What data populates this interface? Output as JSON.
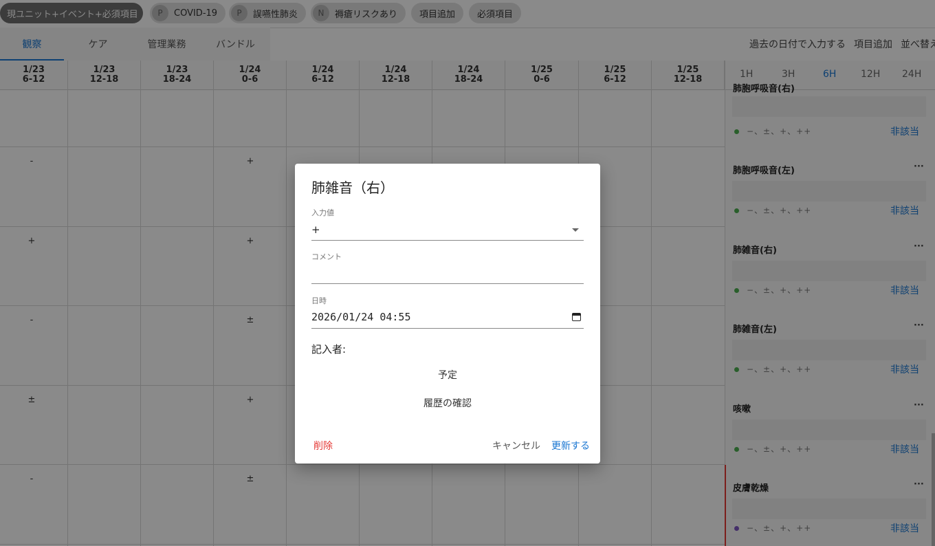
{
  "chips": {
    "filter": "現ユニット+イベント+必須項目",
    "tags": [
      {
        "avatar": "P",
        "label": "COVID-19"
      },
      {
        "avatar": "P",
        "label": "誤嚥性肺炎"
      },
      {
        "avatar": "N",
        "label": "褥瘡リスクあり"
      }
    ],
    "add_item": "項目追加",
    "required": "必須項目"
  },
  "tabs": [
    "観察",
    "ケア",
    "管理業務",
    "バンドル"
  ],
  "active_tab": "観察",
  "toplinks": {
    "past_date": "過去の日付で入力する",
    "add_item": "項目追加",
    "sort": "並べ替え"
  },
  "columns": [
    {
      "date": "1/23",
      "range": "6-12"
    },
    {
      "date": "1/23",
      "range": "12-18"
    },
    {
      "date": "1/23",
      "range": "18-24"
    },
    {
      "date": "1/24",
      "range": "0-6"
    },
    {
      "date": "1/24",
      "range": "6-12"
    },
    {
      "date": "1/24",
      "range": "12-18"
    },
    {
      "date": "1/24",
      "range": "18-24"
    },
    {
      "date": "1/25",
      "range": "0-6"
    },
    {
      "date": "1/25",
      "range": "6-12"
    },
    {
      "date": "1/25",
      "range": "12-18"
    }
  ],
  "rows": [
    {
      "c0": "",
      "c3": ""
    },
    {
      "c0": "-",
      "c3": "+"
    },
    {
      "c0": "+",
      "c3": "+"
    },
    {
      "c0": "-",
      "c3": "±"
    },
    {
      "c0": "±",
      "c3": "+"
    },
    {
      "c0": "-",
      "c3": "±"
    }
  ],
  "intervals": [
    "1H",
    "3H",
    "6H",
    "12H",
    "24H"
  ],
  "active_interval": "6H",
  "items": [
    {
      "title": "肺胞呼吸音(右)",
      "options": "−、±、+、++",
      "na": "非該当",
      "dot_color": "#4caf50"
    },
    {
      "title": "肺胞呼吸音(左)",
      "options": "−、±、+、++",
      "na": "非該当",
      "dot_color": "#4caf50"
    },
    {
      "title": "肺雑音(右)",
      "options": "−、±、+、++",
      "na": "非該当",
      "dot_color": "#4caf50"
    },
    {
      "title": "肺雑音(左)",
      "options": "−、±、+、++",
      "na": "非該当",
      "dot_color": "#4caf50"
    },
    {
      "title": "咳嗽",
      "options": "−、±、+、++",
      "na": "非該当",
      "dot_color": "#4caf50"
    },
    {
      "title": "皮膚乾燥",
      "options": "−、±、+、++",
      "na": "非該当",
      "dot_color": "#7e57c2"
    }
  ],
  "dialog": {
    "title": "肺雑音（右）",
    "input_label": "入力値",
    "input_value": "+",
    "comment_label": "コメント",
    "comment_value": "",
    "datetime_label": "日時",
    "datetime_value": "2026/01/24 04:55",
    "writer_label": "記入者:",
    "schedule": "予定",
    "history": "履歴の確認",
    "delete": "削除",
    "cancel": "キャンセル",
    "update": "更新する"
  }
}
